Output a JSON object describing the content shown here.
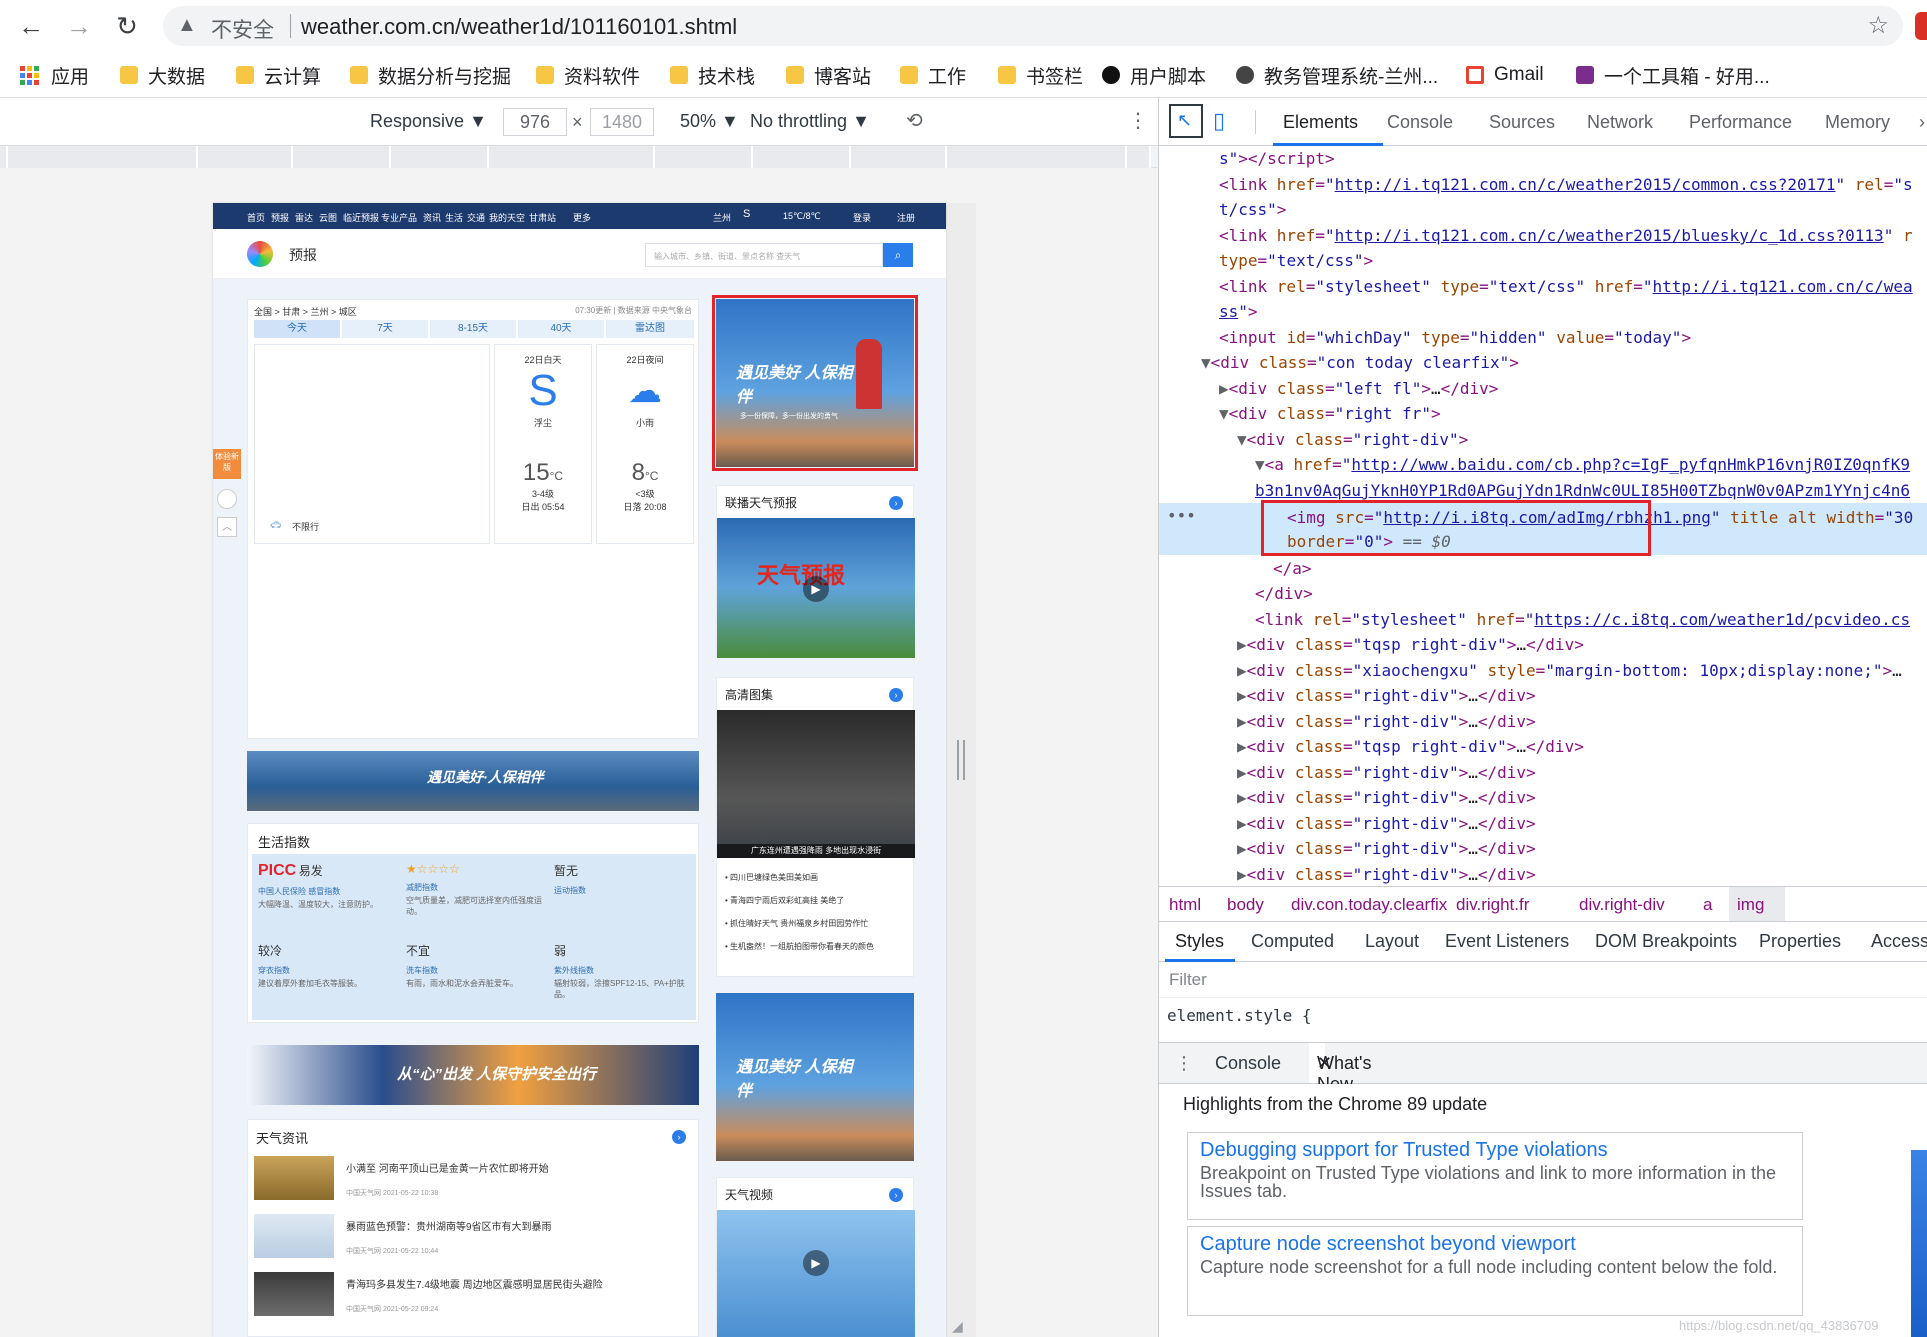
{
  "browser": {
    "insecure_label": "不安全",
    "url": "weather.com.cn/weather1d/101160101.shtml"
  },
  "bookmarks": [
    {
      "label": "应用",
      "icon": "apps-grid-icon"
    },
    {
      "label": "大数据",
      "icon": "folder-icon"
    },
    {
      "label": "云计算",
      "icon": "folder-icon"
    },
    {
      "label": "数据分析与挖掘",
      "icon": "folder-icon"
    },
    {
      "label": "资料软件",
      "icon": "folder-icon"
    },
    {
      "label": "技术栈",
      "icon": "folder-icon"
    },
    {
      "label": "博客站",
      "icon": "folder-icon"
    },
    {
      "label": "工作",
      "icon": "folder-icon"
    },
    {
      "label": "书签栏",
      "icon": "folder-icon"
    },
    {
      "label": "用户脚本",
      "icon": "script-icon"
    },
    {
      "label": "教务管理系统-兰州...",
      "icon": "globe-icon"
    },
    {
      "label": "Gmail",
      "icon": "gmail-icon"
    },
    {
      "label": "一个工具箱 - 好用...",
      "icon": "toolbox-icon"
    }
  ],
  "device_toolbar": {
    "mode": "Responsive",
    "width": "976",
    "height": "1480",
    "zoom": "50%",
    "throttling": "No throttling"
  },
  "site": {
    "nav": [
      "首页",
      "预报",
      "雷达",
      "云图",
      "临近预报",
      "专业产品",
      "资讯",
      "生活",
      "交通",
      "我的天空",
      "甘肃站",
      "更多"
    ],
    "city": "兰州",
    "temp_range": "15℃/8℃",
    "login": "登录",
    "register": "注册",
    "logo_text": "预报",
    "search_placeholder": "输入城市、乡镇、街道、景点名称 查天气",
    "breadcrumb": "全国 > 甘肃 > 兰州 > 城区",
    "update": "07:30更新 | 数据来源 中央气象台",
    "tabs": [
      "今天",
      "7天",
      "8-15天",
      "40天",
      "雷达图"
    ],
    "day": {
      "label": "22日白天",
      "cond": "浮尘",
      "temp": "15",
      "wind": "3-4级",
      "sun": "日出 05:54"
    },
    "night": {
      "label": "22日夜间",
      "cond": "小雨",
      "temp": "8",
      "wind": "<3级",
      "sun": "日落 20:08"
    },
    "temp_unit": "°C",
    "traffic": "不限行",
    "side_badge": "体验新版",
    "banner1": "遇见美好·人保相伴",
    "life_title": "生活指数",
    "life": [
      {
        "brand": "PICC",
        "level": "易发",
        "name": "中国人民保险 感冒指数",
        "desc": "大幅降温、温度较大，注意防护。"
      },
      {
        "brand": "",
        "level": "",
        "name": "减肥指数",
        "desc": "空气质量差，减肥可选择室内低强度运动。"
      },
      {
        "brand": "",
        "level": "暂无",
        "name": "运动指数",
        "desc": ""
      },
      {
        "brand": "",
        "level": "较冷",
        "name": "穿衣指数",
        "desc": "建议着厚外套加毛衣等服装。"
      },
      {
        "brand": "",
        "level": "不宜",
        "name": "洗车指数",
        "desc": "有雨，雨水和泥水会弄脏爱车。"
      },
      {
        "brand": "",
        "level": "弱",
        "name": "紫外线指数",
        "desc": "辐射较弱，涂擦SPF12-15、PA+护肤品。"
      }
    ],
    "banner2": "从“心”出发 人保守护安全出行",
    "news_title": "天气资讯",
    "news": [
      {
        "title": "小满至 河南平顶山已是金黄一片农忙即将开始",
        "meta": "中国天气网 2021-05-22 10:38"
      },
      {
        "title": "暴雨蓝色预警：贵州湖南等9省区市有大到暴雨",
        "meta": "中国天气网 2021-05-22 10:44"
      },
      {
        "title": "青海玛多县发生7.4级地震 周边地区震感明显居民街头避险",
        "meta": "中国天气网 2021-05-22 09:24"
      }
    ],
    "ad_top": "遇见美好 人保相伴",
    "ad_top_sub": "多一份保障，多一份出发的勇气",
    "broadcast_title": "联播天气预报",
    "broadcast_img": "天气预报",
    "gallery_title": "高清图集",
    "gallery_caption": "广东连州遭遇强降雨 多地出现水浸街",
    "gallery_list": [
      "四川巴塘绿色美田美如画",
      "青海四宁雨后双彩虹高挂 美绝了",
      "抓住晴好天气 贵州福泉乡村田园劳作忙",
      "生机盎然！一组航拍图带你看春天的颜色"
    ],
    "ad_mid": "遇见美好 人保相伴",
    "video_title": "天气视频"
  },
  "devtools": {
    "tabs": [
      "Elements",
      "Console",
      "Sources",
      "Network",
      "Performance",
      "Memory"
    ],
    "breadcrumbs": [
      "html",
      "body",
      "div.con.today.clearfix",
      "div.right.fr",
      "div.right-div",
      "a",
      "img"
    ],
    "style_tabs": [
      "Styles",
      "Computed",
      "Layout",
      "Event Listeners",
      "DOM Breakpoints",
      "Properties",
      "Access"
    ],
    "filter_placeholder": "Filter",
    "element_style": "element.style {",
    "drawer_tabs": [
      "Console",
      "What's New"
    ],
    "highlights": "Highlights from the Chrome 89 update",
    "cards": [
      {
        "title": "Debugging support for Trusted Type violations",
        "desc": "Breakpoint on Trusted Type violations and link to more information in the Issues tab."
      },
      {
        "title": "Capture node screenshot beyond viewport",
        "desc": "Capture node screenshot for a full node including content below the fold."
      }
    ],
    "watermark": "https://blog.csdn.net/qq_43836709"
  },
  "colors": {
    "accent": "#1a73e8",
    "highlight": "#e0242a",
    "site_nav": "#1d3a6e",
    "selected_row": "#cfe8fc"
  }
}
